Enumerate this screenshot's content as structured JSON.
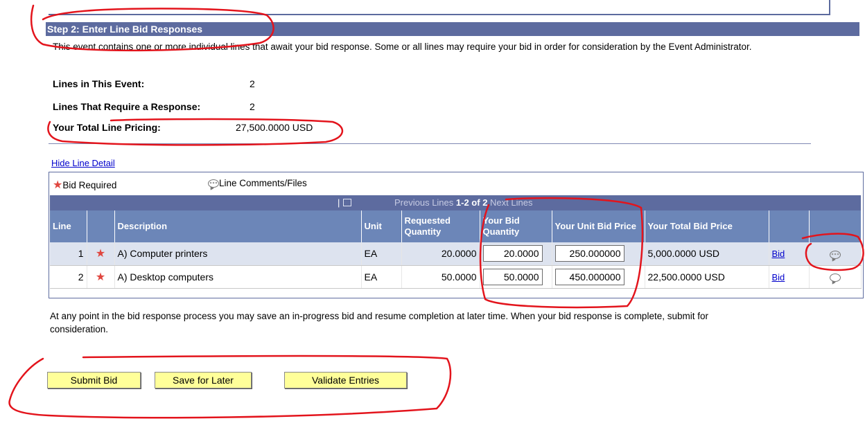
{
  "section": {
    "title": "Step 2: Enter Line Bid Responses",
    "intro": "This event contains one or more individual lines that await your bid response. Some or all lines may require your bid in order for consideration by the Event Administrator."
  },
  "stats": [
    {
      "label": "Lines in This Event:",
      "value": "2"
    },
    {
      "label": "Lines That Require a Response:",
      "value": "2"
    },
    {
      "label": "Your Total Line Pricing:",
      "value": "27,500.0000 USD"
    }
  ],
  "hide_detail_link": "Hide Line Detail",
  "legend": {
    "bid_required": "Bid Required",
    "comments": "Line Comments/Files"
  },
  "nav": {
    "previous": "Previous Lines",
    "range": "1-2 of 2",
    "next": "Next Lines"
  },
  "columns": [
    "Line",
    "",
    "Description",
    "Unit",
    "Requested Quantity",
    "Your Bid Quantity",
    "Your Unit Bid Price",
    "Your Total Bid Price",
    "",
    ""
  ],
  "rows": [
    {
      "line": "1",
      "description": "A) Computer printers",
      "unit": "EA",
      "requested_qty": "20.0000",
      "bid_qty": "20.0000",
      "unit_price": "250.000000",
      "total": "5,000.0000 USD",
      "bid_link": "Bid",
      "comment_icon": "comment-with-files-icon"
    },
    {
      "line": "2",
      "description": "A) Desktop computers",
      "unit": "EA",
      "requested_qty": "50.0000",
      "bid_qty": "50.0000",
      "unit_price": "450.000000",
      "total": "22,500.0000 USD",
      "bid_link": "Bid",
      "comment_icon": "comment-empty-icon"
    }
  ],
  "footer_text": "At any point in the bid response process you may save an in-progress bid and resume completion at later time. When your bid response is complete, submit for consideration.",
  "buttons": {
    "submit": "Submit Bid",
    "save": "Save for Later",
    "validate": "Validate Entries"
  },
  "colors": {
    "header": "#5d6b9f",
    "column_header": "#6c86b8",
    "button": "#ffff99",
    "annotation": "#e3141c"
  }
}
